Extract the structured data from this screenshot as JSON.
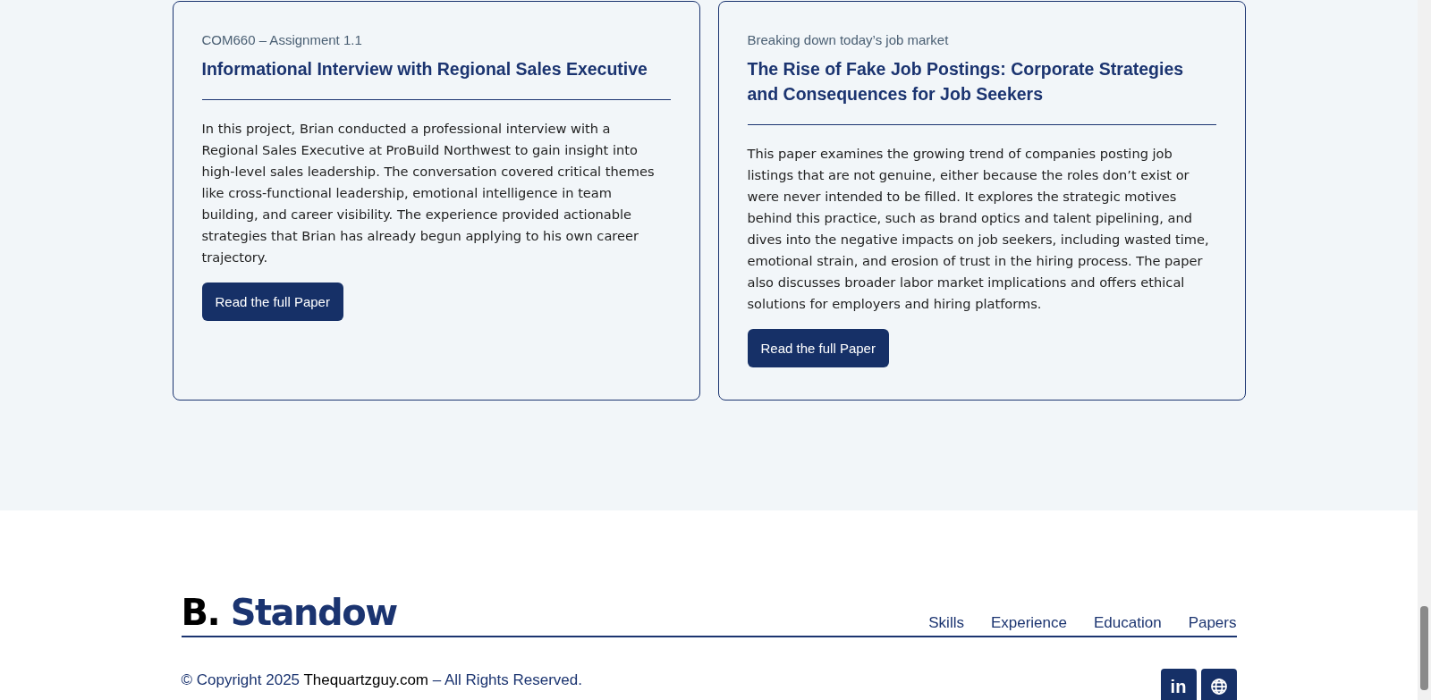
{
  "papers": [
    {
      "eyebrow": "COM660 – Assignment 1.1",
      "title": "Informational Interview with Regional Sales Executive",
      "summary": "In this project, Brian conducted a professional interview with a Regional Sales Executive at ProBuild Northwest to gain insight into high-level sales leadership. The conversation covered critical themes like cross-functional leadership, emotional intelligence in team building, and career visibility. The experience provided actionable strategies that Brian has already begun applying to his own career trajectory.",
      "button": "Read the full Paper"
    },
    {
      "eyebrow": "Breaking down today’s job market",
      "title": "The Rise of Fake Job Postings: Corporate Strategies and Consequences for Job Seekers",
      "summary": "This paper examines the growing trend of companies posting job listings that are not genuine, either because the roles don’t exist or were never intended to be filled. It explores the strategic motives behind this practice, such as brand optics and talent pipelining, and dives into the negative impacts on job seekers, including wasted time, emotional strain, and erosion of trust in the hiring process. The paper also discusses broader labor market implications and offers ethical solutions for employers and hiring platforms.",
      "button": "Read the full Paper"
    }
  ],
  "footer": {
    "logo_initial": "B.",
    "logo_name": "Standow",
    "nav": [
      "Skills",
      "Experience",
      "Education",
      "Papers"
    ],
    "copyright_prefix": "© Copyright 2025",
    "copyright_link": "Thequartzguy.com",
    "copyright_suffix": "– All Rights Reserved.",
    "social": [
      {
        "kind": "linkedin",
        "label": "in"
      },
      {
        "kind": "globe"
      }
    ]
  }
}
